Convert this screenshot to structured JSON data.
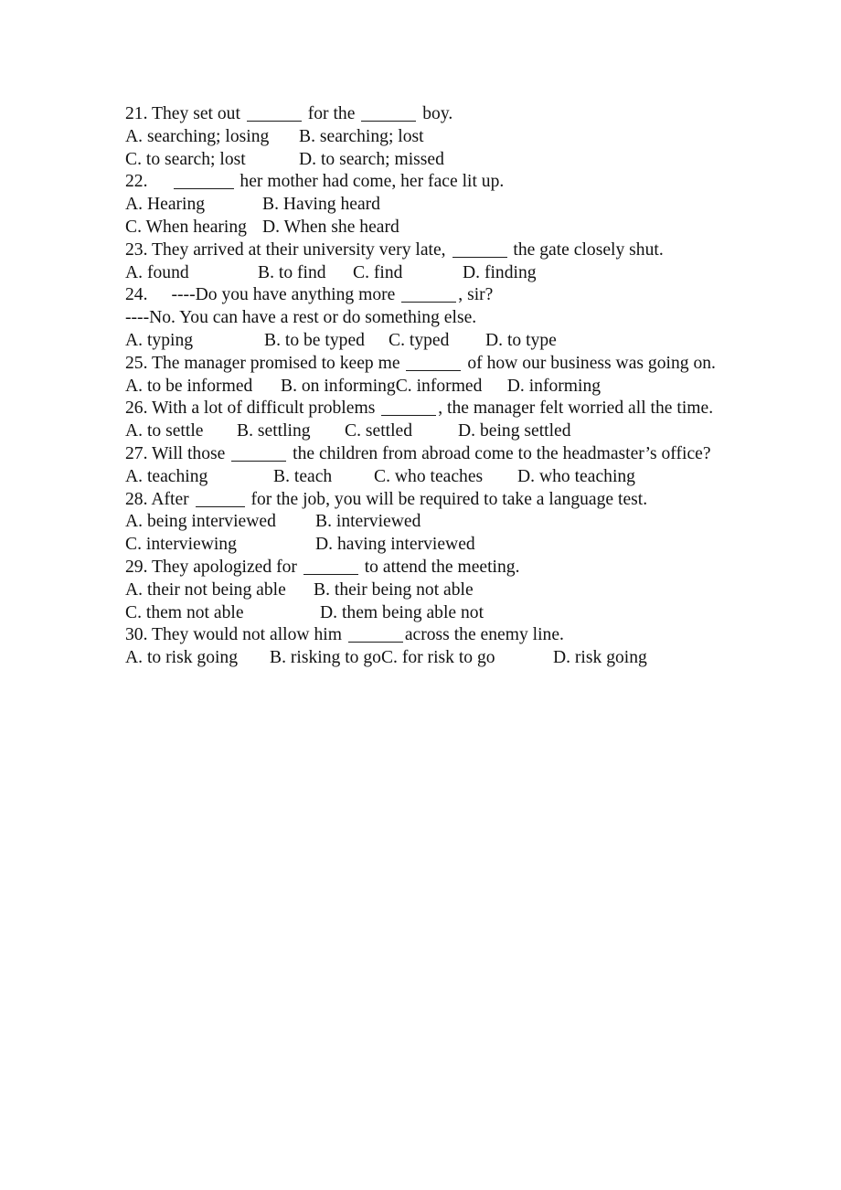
{
  "document": {
    "type": "grammar-worksheet",
    "background_color": "#ffffff",
    "text_color": "#121212",
    "blank_marker": "______"
  },
  "questions": [
    {
      "number": "21.",
      "stem_before": "They set out",
      "stem_middle": "for the",
      "stem_after": "boy.",
      "stem_full": "21. They set out ______ for the ______ boy.",
      "options_rows": [
        [
          {
            "label": "A.",
            "text": "searching; losing"
          },
          {
            "label": "B.",
            "text": "searching; lost"
          }
        ],
        [
          {
            "label": "C.",
            "text": "to search; lost"
          },
          {
            "label": "D.",
            "text": "to search; missed"
          }
        ]
      ]
    },
    {
      "number": "22.",
      "stem_after": "her mother had come, her face lit up.",
      "stem_full": "22.  ______ her mother had come, her face lit up.",
      "options_rows": [
        [
          {
            "label": "A.",
            "text": "Hearing"
          },
          {
            "label": "B.",
            "text": "Having heard"
          }
        ],
        [
          {
            "label": "C.",
            "text": "When hearing"
          },
          {
            "label": "D.",
            "text": "When she heard"
          }
        ]
      ]
    },
    {
      "number": "23.",
      "stem_before": "They arrived at their university very late,",
      "stem_after": "the gate closely shut.",
      "stem_full": "23. They arrived at their university very late, ______ the gate closely shut.",
      "options_rows": [
        [
          {
            "label": "A.",
            "text": "found"
          },
          {
            "label": "B.",
            "text": "to find"
          },
          {
            "label": "C.",
            "text": "find"
          },
          {
            "label": "D.",
            "text": "finding"
          }
        ]
      ]
    },
    {
      "number": "24.",
      "stem_before": "----Do you have anything more",
      "stem_after": ", sir?",
      "stem_second_line": "----No. You can have a rest or do something else.",
      "stem_full": "24.  ----Do you have anything more ______, sir?",
      "options_rows": [
        [
          {
            "label": "A.",
            "text": "typing"
          },
          {
            "label": "B.",
            "text": "to be typed"
          },
          {
            "label": "C.",
            "text": "typed"
          },
          {
            "label": "D.",
            "text": "to type"
          }
        ]
      ]
    },
    {
      "number": "25.",
      "stem_before": "The manager promised to keep me",
      "stem_after": "of how our business was going on.",
      "stem_full": "25. The manager promised to keep me ______ of how our business was going on.",
      "options_rows": [
        [
          {
            "label": "A.",
            "text": "to be informed"
          },
          {
            "label": "B.",
            "text": "on informing"
          },
          {
            "label": "C.",
            "text": "informed"
          },
          {
            "label": "D.",
            "text": "informing"
          }
        ]
      ]
    },
    {
      "number": "26.",
      "stem_before": "With a lot of difficult problems",
      "stem_after": ", the manager felt worried all the time.",
      "stem_full": "26. With a lot of difficult problems ______, the manager felt worried all the time.",
      "options_rows": [
        [
          {
            "label": "A.",
            "text": "to settle"
          },
          {
            "label": "B.",
            "text": "settling"
          },
          {
            "label": "C.",
            "text": "settled"
          },
          {
            "label": "D.",
            "text": "being settled"
          }
        ]
      ]
    },
    {
      "number": "27.",
      "stem_before": "Will those",
      "stem_after": "the children from abroad come to the headmaster’s office?",
      "stem_full": "27. Will those ______ the children from abroad come to the headmaster’s office?",
      "options_rows": [
        [
          {
            "label": "A.",
            "text": "teaching"
          },
          {
            "label": "B.",
            "text": "teach"
          },
          {
            "label": "C.",
            "text": "who teaches"
          },
          {
            "label": "D.",
            "text": "who teaching"
          }
        ]
      ]
    },
    {
      "number": "28.",
      "stem_before": "After",
      "stem_after": "for the job, you will be required to take a language test.",
      "stem_full": "28. After ______ for the job, you will be required to take a language test.",
      "options_rows": [
        [
          {
            "label": "A.",
            "text": "being interviewed"
          },
          {
            "label": "B.",
            "text": "interviewed"
          }
        ],
        [
          {
            "label": "C.",
            "text": "interviewing"
          },
          {
            "label": "D.",
            "text": "having interviewed"
          }
        ]
      ]
    },
    {
      "number": "29.",
      "stem_before": "They apologized for",
      "stem_after": "to attend the meeting.",
      "stem_full": "29. They apologized for ______ to attend the meeting.",
      "options_rows": [
        [
          {
            "label": "A.",
            "text": "their not being able"
          },
          {
            "label": "B.",
            "text": "their being not able"
          }
        ],
        [
          {
            "label": "C.",
            "text": "them not able"
          },
          {
            "label": "D.",
            "text": "them being able not"
          }
        ]
      ]
    },
    {
      "number": "30.",
      "stem_before": "They would not allow him",
      "stem_after": "across the enemy line.",
      "stem_full": "30. They would not allow him ______ across the enemy line.",
      "options_rows": [
        [
          {
            "label": "A.",
            "text": "to risk going"
          },
          {
            "label": "B.",
            "text": "risking to go"
          },
          {
            "label": "C.",
            "text": "for risk to go"
          },
          {
            "label": "D.",
            "text": "risk going"
          }
        ]
      ]
    }
  ]
}
